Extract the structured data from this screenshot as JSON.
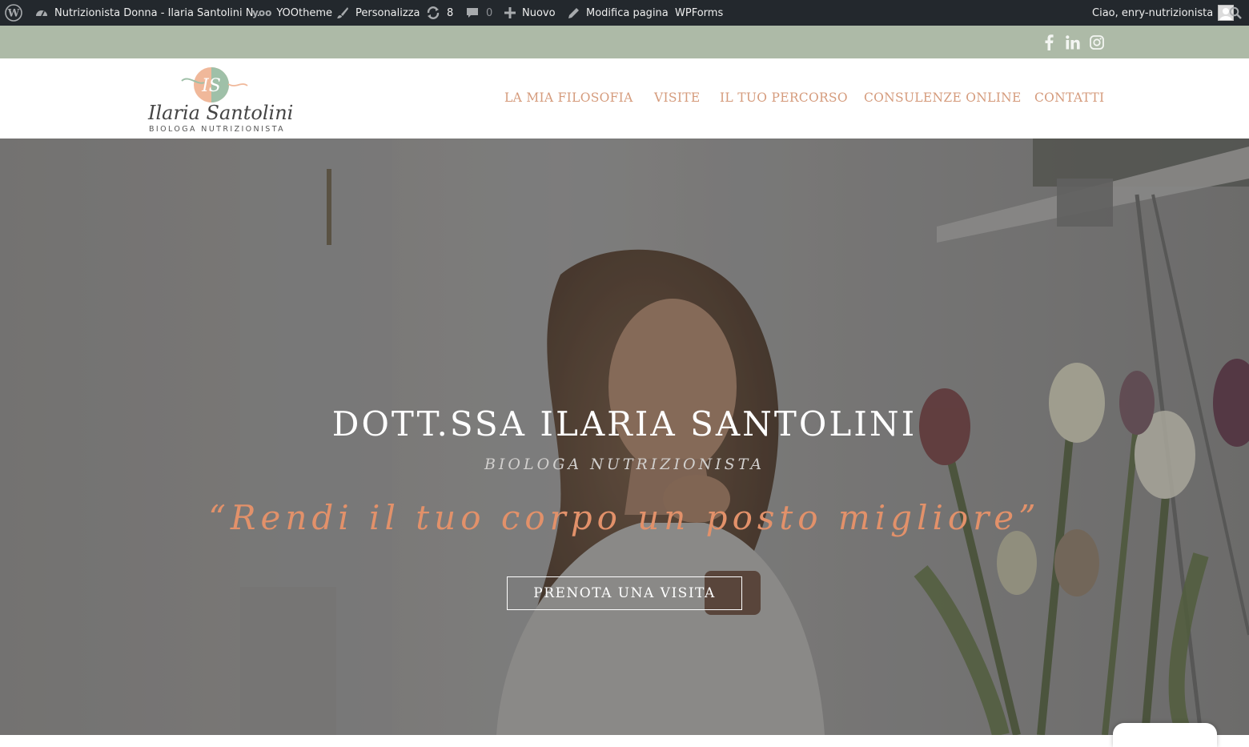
{
  "admin_bar": {
    "site_name": "Nutrizionista Donna - Ilaria Santolini N...",
    "yootheme": "YOOtheme",
    "customize": "Personalizza",
    "updates_count": "8",
    "comments_count": "0",
    "new_label": "Nuovo",
    "edit_page": "Modifica pagina",
    "wpforms": "WPForms",
    "greeting": "Ciao, enry-nutrizionista"
  },
  "social": {
    "icons": [
      "facebook-icon",
      "linkedin-icon",
      "instagram-icon"
    ]
  },
  "logo": {
    "monogram": "IS",
    "script_name": "Ilaria Santolini",
    "tagline": "BIOLOGA NUTRIZIONISTA"
  },
  "nav": {
    "items": [
      {
        "label": "LA MIA FILOSOFIA"
      },
      {
        "label": "VISITE"
      },
      {
        "label": "IL TUO PERCORSO"
      },
      {
        "label": "CONSULENZE ONLINE"
      },
      {
        "label": "CONTATTI"
      }
    ]
  },
  "hero": {
    "title": "DOTT.SSA ILARIA SANTOLINI",
    "subtitle": "BIOLOGA NUTRIZIONISTA",
    "quote": "“Rendi il tuo corpo un posto migliore”",
    "cta": "PRENOTA UNA VISITA"
  },
  "colors": {
    "admin_bar_bg": "#23282d",
    "top_bar_bg": "#adbaa7",
    "nav_text": "#d59b7c",
    "quote_text": "#e2916a",
    "logo_peach": "#f0b89a",
    "logo_green": "#9fc0a8"
  }
}
